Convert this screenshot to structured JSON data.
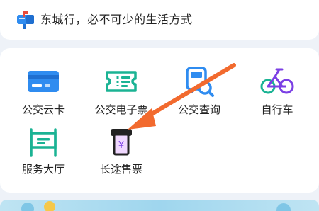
{
  "header": {
    "slogan": "东城行，必不可少的生活方式",
    "icon": "mailbox-icon"
  },
  "services": [
    {
      "label": "公交云卡",
      "icon": "bus-card-icon"
    },
    {
      "label": "公交电子票",
      "icon": "e-ticket-icon"
    },
    {
      "label": "公交查询",
      "icon": "bus-search-icon"
    },
    {
      "label": "自行车",
      "icon": "bicycle-icon"
    },
    {
      "label": "服务大厅",
      "icon": "service-hall-icon"
    },
    {
      "label": "长途售票",
      "icon": "ticket-machine-icon"
    }
  ],
  "colors": {
    "blue": "#2f8cf0",
    "teal": "#1bb394",
    "purple": "#7b3fe4",
    "highlight": "#f0d8ff",
    "annotation_arrow": "#f26a2e"
  }
}
